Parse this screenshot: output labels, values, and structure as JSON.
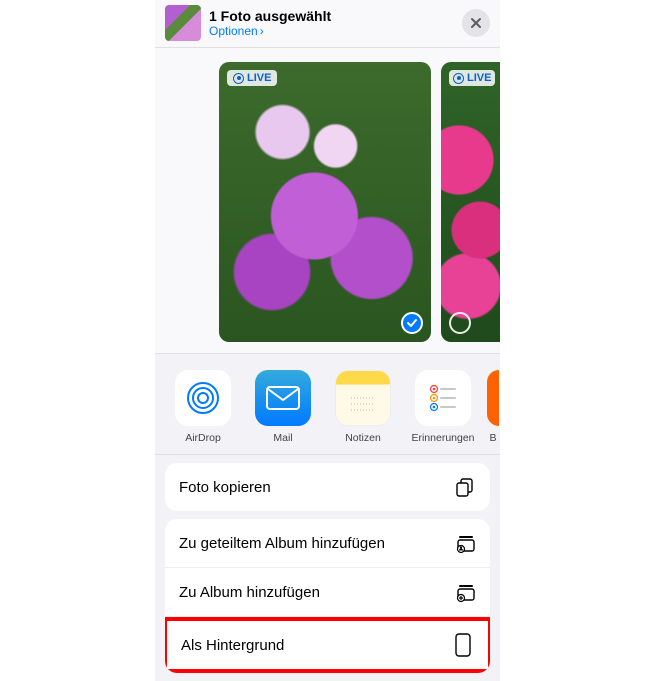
{
  "header": {
    "title": "1 Foto ausgewählt",
    "options_label": "Optionen"
  },
  "photos": [
    {
      "live_label": "LIVE",
      "selected": true
    },
    {
      "live_label": "LIVE",
      "selected": false
    }
  ],
  "apps": [
    {
      "id": "airdrop",
      "label": "AirDrop"
    },
    {
      "id": "mail",
      "label": "Mail"
    },
    {
      "id": "notes",
      "label": "Notizen"
    },
    {
      "id": "reminders",
      "label": "Erinnerungen"
    },
    {
      "id": "shortcuts",
      "label": "B"
    }
  ],
  "actions": {
    "copy": "Foto kopieren",
    "add_shared": "Zu geteiltem Album hinzufügen",
    "add_album": "Zu Album hinzufügen",
    "wallpaper": "Als Hintergrund"
  },
  "colors": {
    "accent": "#007aff",
    "highlight": "#ff0000"
  }
}
